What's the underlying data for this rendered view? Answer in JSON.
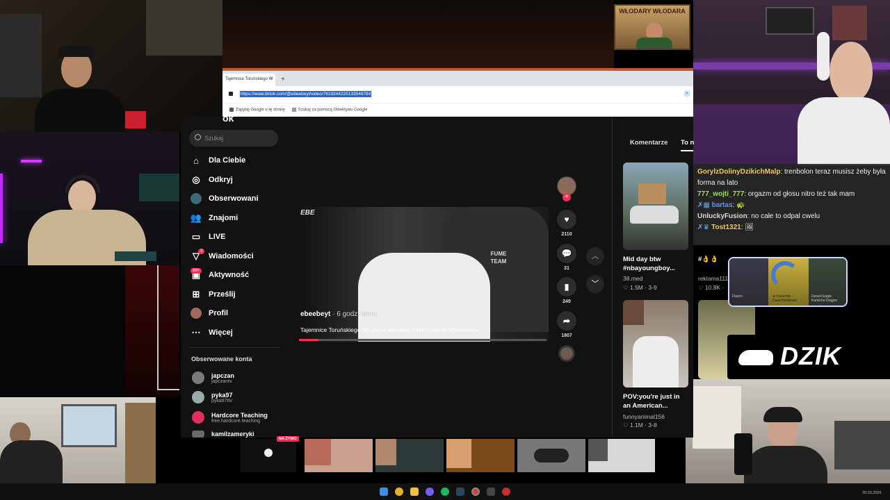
{
  "overlay": {
    "top_right_banner": "WŁODARY WŁODARA",
    "dzik_logo": "DZIK",
    "knife_card": {
      "left_label": "Fiasco",
      "center_label": "★ Karambit\nCase Hardened",
      "right_label": "Desert Eagle\nKumicho Dragon"
    }
  },
  "browser": {
    "tab_title": "Tajemnice Toruńskiego W",
    "tab_close": "×",
    "new_tab": "+",
    "url": "https://www.tiktok.com/@ebeebeyt/video/7619344225133546784",
    "suggestion_1": "Zapytaj Google o tę stronę",
    "suggestion_2": "Szukaj za pomocą Obiektywu Google"
  },
  "tiktok": {
    "logo_fragment": "ok",
    "search_placeholder": "Szukaj",
    "nav": [
      {
        "label": "Dla Ciebie",
        "icon": "home-icon"
      },
      {
        "label": "Odkryj",
        "icon": "compass-icon"
      },
      {
        "label": "Obserwowani",
        "icon": "following-icon"
      },
      {
        "label": "Znajomi",
        "icon": "friends-icon"
      },
      {
        "label": "LIVE",
        "icon": "live-icon"
      },
      {
        "label": "Wiadomości",
        "icon": "messages-icon",
        "badge": "3"
      },
      {
        "label": "Aktywność",
        "icon": "activity-icon",
        "badge": "99+"
      },
      {
        "label": "Prześlij",
        "icon": "upload-icon"
      },
      {
        "label": "Profil",
        "icon": "profile-icon"
      },
      {
        "label": "Więcej",
        "icon": "more-icon"
      }
    ],
    "followed_title": "Obserwowane konta",
    "followed": [
      {
        "name": "japczan",
        "handle": "japczantv"
      },
      {
        "name": "pyka97",
        "handle": "pyka97ttv"
      },
      {
        "name": "Hardcore Teaching",
        "handle": "free.hardcore.teaching"
      },
      {
        "name": "kamilzameryki",
        "handle": ""
      }
    ],
    "video": {
      "author": "ebeebeyt",
      "time": "· 6 godz. temu",
      "caption": "Tajemnice Toruńskiego Wzgórza #ebeebe #deniszałęcki #famemma",
      "watermark": "EBE",
      "shirt_text": "FUME TEAM",
      "progress": 0.08
    },
    "actions": {
      "likes": "2110",
      "comments": "31",
      "saves": "249",
      "shares": "1807"
    },
    "panel": {
      "tab_comments": "Komentarze",
      "tab_more": "To n",
      "videos": [
        {
          "title": "Mid day btw #nbayoungboy...",
          "author": "38.med",
          "views": "♡ 1.5M · 3-9"
        },
        {
          "title": "#👌👌👌🎁",
          "author": "reklama111",
          "views": "♡ 10.8K ·"
        },
        {
          "title": "POV:you're just in an American...",
          "author": "funnyanimal156",
          "views": "♡ 1.1M · 3-8"
        }
      ]
    }
  },
  "chat": [
    {
      "user": "GorylzDolinyDzikichMalp",
      "color": "#f0c95a",
      "msg": "trenbolon teraz musisz żeby była forma na lato"
    },
    {
      "user": "777_wojti_777",
      "color": "#9be35a",
      "msg": "orgazm od głosu nitro też tak mam"
    },
    {
      "user": "bartas",
      "color": "#6a8cff",
      "msg": "🐢"
    },
    {
      "user": "UnluckyFusion",
      "color": "#d9d9d9",
      "msg": "no całe to odpal cwelu"
    },
    {
      "user": "Tost1321",
      "color": "#f0c95a",
      "msg": "🖼"
    }
  ],
  "strip": {
    "live_badge": "NA ŻYWO"
  },
  "taskbar": {
    "clock": "20.03.2026"
  },
  "colors": {
    "accent": "#fe2c55",
    "chat_bg": "#282828",
    "browser_url_highlight": "#2a62c9"
  }
}
